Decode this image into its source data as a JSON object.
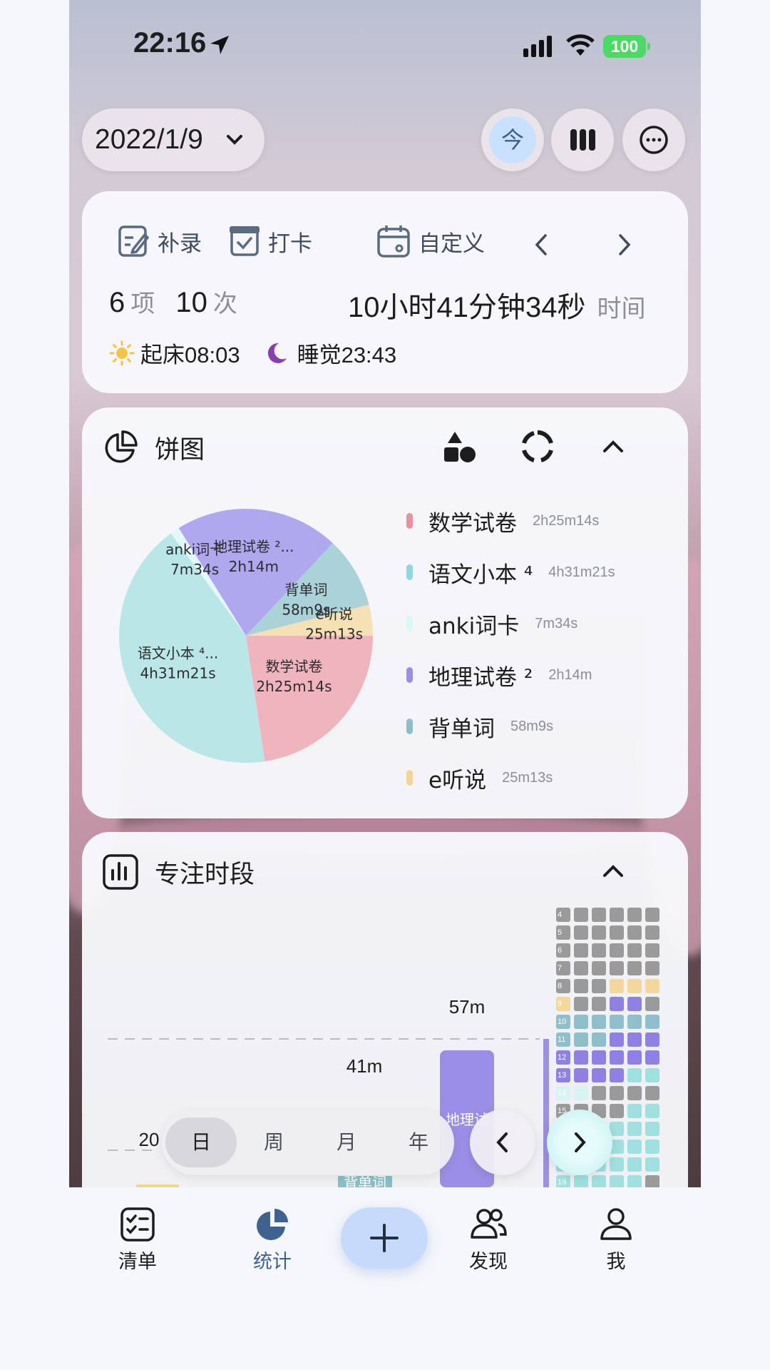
{
  "status": {
    "time": "22:16",
    "battery": "100"
  },
  "header": {
    "date": "2022/1/9",
    "today_label": "今"
  },
  "summary": {
    "tools": {
      "backfill": "补录",
      "checkin": "打卡",
      "custom": "自定义"
    },
    "items_count": "6",
    "items_unit": "项",
    "times_count": "10",
    "times_unit": "次",
    "duration": "10小时41分钟34秒",
    "duration_unit": "时间",
    "wake": "起床08:03",
    "sleep": "睡觉23:43"
  },
  "pie_section": {
    "title": "饼图"
  },
  "chart_data": [
    {
      "type": "pie",
      "title": "饼图",
      "slices": [
        {
          "name": "数学试卷",
          "duration": "2h25m14s",
          "pie_label": "数学试卷\n2h25m14s",
          "value_minutes": 145.2,
          "color": "#f0b4be",
          "legend_color": "#e8919f"
        },
        {
          "name": "语文小本 ⁴",
          "duration": "4h31m21s",
          "pie_label": "语文小本 ⁴...\n4h31m21s",
          "value_minutes": 271.4,
          "color": "#bbe6e8",
          "legend_color": "#8ed7dc"
        },
        {
          "name": "anki词卡",
          "duration": "7m34s",
          "pie_label": "anki词卡\n7m34s",
          "value_minutes": 7.6,
          "color": "#e3f8f9",
          "legend_color": "#dbf6f7"
        },
        {
          "name": "地理试卷 ²",
          "duration": "2h14m",
          "pie_label": "地理试卷 ²...\n2h14m",
          "value_minutes": 134,
          "color": "#b0a8ef",
          "legend_color": "#9b8ee6"
        },
        {
          "name": "背单词",
          "duration": "58m9s",
          "pie_label": "背单词\n58m9s",
          "value_minutes": 58.2,
          "color": "#abd2d8",
          "legend_color": "#8cbfc8"
        },
        {
          "name": "e听说",
          "duration": "25m13s",
          "pie_label": "e听说\n25m13s",
          "value_minutes": 25.2,
          "color": "#f6e1b4",
          "legend_color": "#f2d593"
        }
      ]
    },
    {
      "type": "bar",
      "title": "专注时段",
      "value_labels": [
        "57m",
        "41m",
        "20"
      ],
      "bar_texts": [
        "地理试",
        "背单词"
      ]
    }
  ],
  "focus_section": {
    "title": "专注时段",
    "heatmap_rows": [
      "4",
      "5",
      "6",
      "7",
      "8",
      "9",
      "10",
      "11",
      "12",
      "13",
      "14",
      "15",
      "16",
      "17",
      "18",
      "19"
    ]
  },
  "segment": {
    "day": "日",
    "week": "周",
    "month": "月",
    "year": "年"
  },
  "bottom_nav": {
    "list": "清单",
    "stats": "统计",
    "discover": "发现",
    "me": "我"
  }
}
